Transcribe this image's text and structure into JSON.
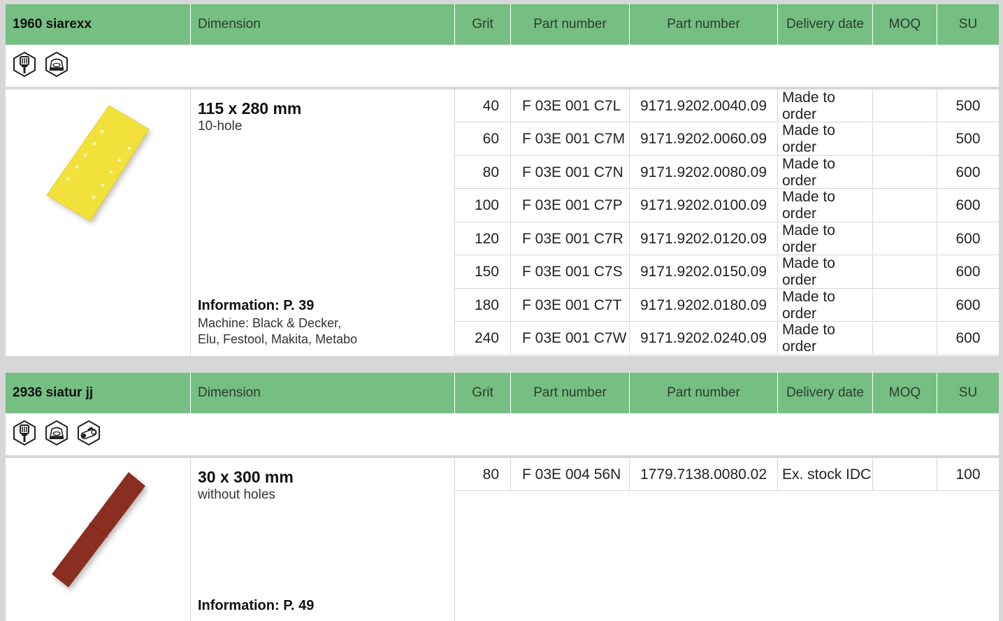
{
  "sections": [
    {
      "header": {
        "title": "1960 siarexx",
        "dimension": "Dimension",
        "grit": "Grit",
        "part_number_1": "Part number",
        "part_number_2": "Part number",
        "delivery_date": "Delivery date",
        "moq": "MOQ",
        "su": "SU"
      },
      "icons": [
        "paint-brush-icon",
        "sanding-machine-icon"
      ],
      "product_image": "yellow-10-hole-sanding-sheet-image",
      "dimension": "115 x 280 mm",
      "holes": "10-hole",
      "information": "Information: P. 39",
      "machine_line1": "Machine: Black & Decker,",
      "machine_line2": "Elu, Festool, Makita, Metabo",
      "rows": [
        {
          "grit": "40",
          "part_number_1": "F 03E 001 C7L",
          "part_number_2": "9171.9202.0040.09",
          "delivery": "Made to order",
          "moq": "",
          "su": "500"
        },
        {
          "grit": "60",
          "part_number_1": "F 03E 001 C7M",
          "part_number_2": "9171.9202.0060.09",
          "delivery": "Made to order",
          "moq": "",
          "su": "500"
        },
        {
          "grit": "80",
          "part_number_1": "F 03E 001 C7N",
          "part_number_2": "9171.9202.0080.09",
          "delivery": "Made to order",
          "moq": "",
          "su": "600"
        },
        {
          "grit": "100",
          "part_number_1": "F 03E 001 C7P",
          "part_number_2": "9171.9202.0100.09",
          "delivery": "Made to order",
          "moq": "",
          "su": "600"
        },
        {
          "grit": "120",
          "part_number_1": "F 03E 001 C7R",
          "part_number_2": "9171.9202.0120.09",
          "delivery": "Made to order",
          "moq": "",
          "su": "600"
        },
        {
          "grit": "150",
          "part_number_1": "F 03E 001 C7S",
          "part_number_2": "9171.9202.0150.09",
          "delivery": "Made to order",
          "moq": "",
          "su": "600"
        },
        {
          "grit": "180",
          "part_number_1": "F 03E 001 C7T",
          "part_number_2": "9171.9202.0180.09",
          "delivery": "Made to order",
          "moq": "",
          "su": "600"
        },
        {
          "grit": "240",
          "part_number_1": "F 03E 001 C7W",
          "part_number_2": "9171.9202.0240.09",
          "delivery": "Made to order",
          "moq": "",
          "su": "600"
        }
      ]
    },
    {
      "header": {
        "title": "2936 siatur jj",
        "dimension": "Dimension",
        "grit": "Grit",
        "part_number_1": "Part number",
        "part_number_2": "Part number",
        "delivery_date": "Delivery date",
        "moq": "MOQ",
        "su": "SU"
      },
      "icons": [
        "paint-brush-icon",
        "sanding-machine-icon",
        "belt-sander-icon"
      ],
      "product_image": "brown-sanding-strip-image",
      "dimension": "30 x 300 mm",
      "holes": "without holes",
      "information": "Information: P. 49",
      "rows": [
        {
          "grit": "80",
          "part_number_1": "F 03E 004 56N",
          "part_number_2": "1779.7138.0080.02",
          "delivery": "Ex. stock IDC",
          "moq": "",
          "su": "100"
        }
      ]
    }
  ],
  "colors": {
    "header_green": "#75bf82",
    "background": "#d7d7d7",
    "sheet_yellow": "#f2e13a",
    "strip_brown": "#8a2f22"
  }
}
